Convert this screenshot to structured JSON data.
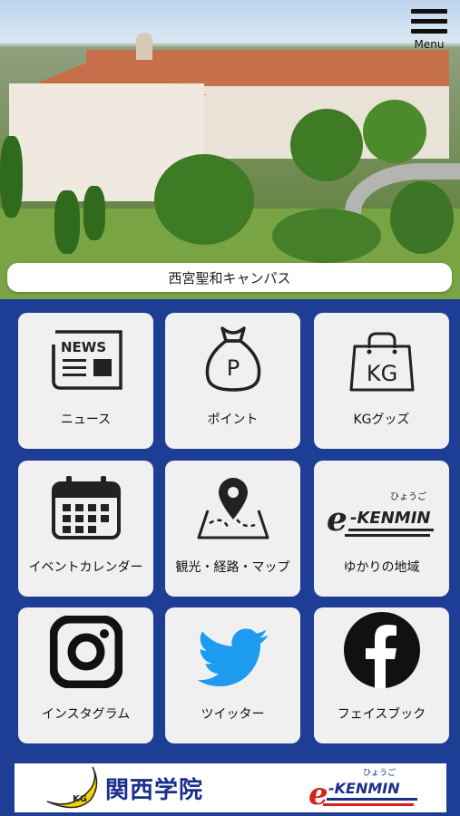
{
  "header": {
    "menu_label": "Menu",
    "campus_name": "西宮聖和キャンパス"
  },
  "tiles": [
    {
      "label": "ニュース",
      "icon": "news-icon",
      "icon_text": "NEWS"
    },
    {
      "label": "ポイント",
      "icon": "point-bag-icon",
      "icon_text": "P"
    },
    {
      "label": "KGグッズ",
      "icon": "kg-goods-bag-icon",
      "icon_text": "KG"
    },
    {
      "label": "イベントカレンダー",
      "icon": "calendar-icon"
    },
    {
      "label": "観光・経路・マップ",
      "icon": "map-pin-icon"
    },
    {
      "label": "ゆかりの地域",
      "icon": "ekenmin-logo",
      "icon_text": "e-KENMIN",
      "icon_ruby": "ひょうご"
    },
    {
      "label": "インスタグラム",
      "icon": "instagram-icon"
    },
    {
      "label": "ツイッター",
      "icon": "twitter-icon"
    },
    {
      "label": "フェイスブック",
      "icon": "facebook-icon",
      "icon_text": "f"
    }
  ],
  "banner": {
    "university_name": "関西学院",
    "ekenmin_text": "e-KENMIN",
    "ekenmin_ruby": "ひょうご"
  },
  "colors": {
    "panel_bg": "#1e3d94",
    "tile_bg": "#f0f0f0",
    "twitter_blue": "#1d9bf0",
    "kg_blue": "#1b2f8c",
    "ekenmin_red": "#d7231b"
  }
}
